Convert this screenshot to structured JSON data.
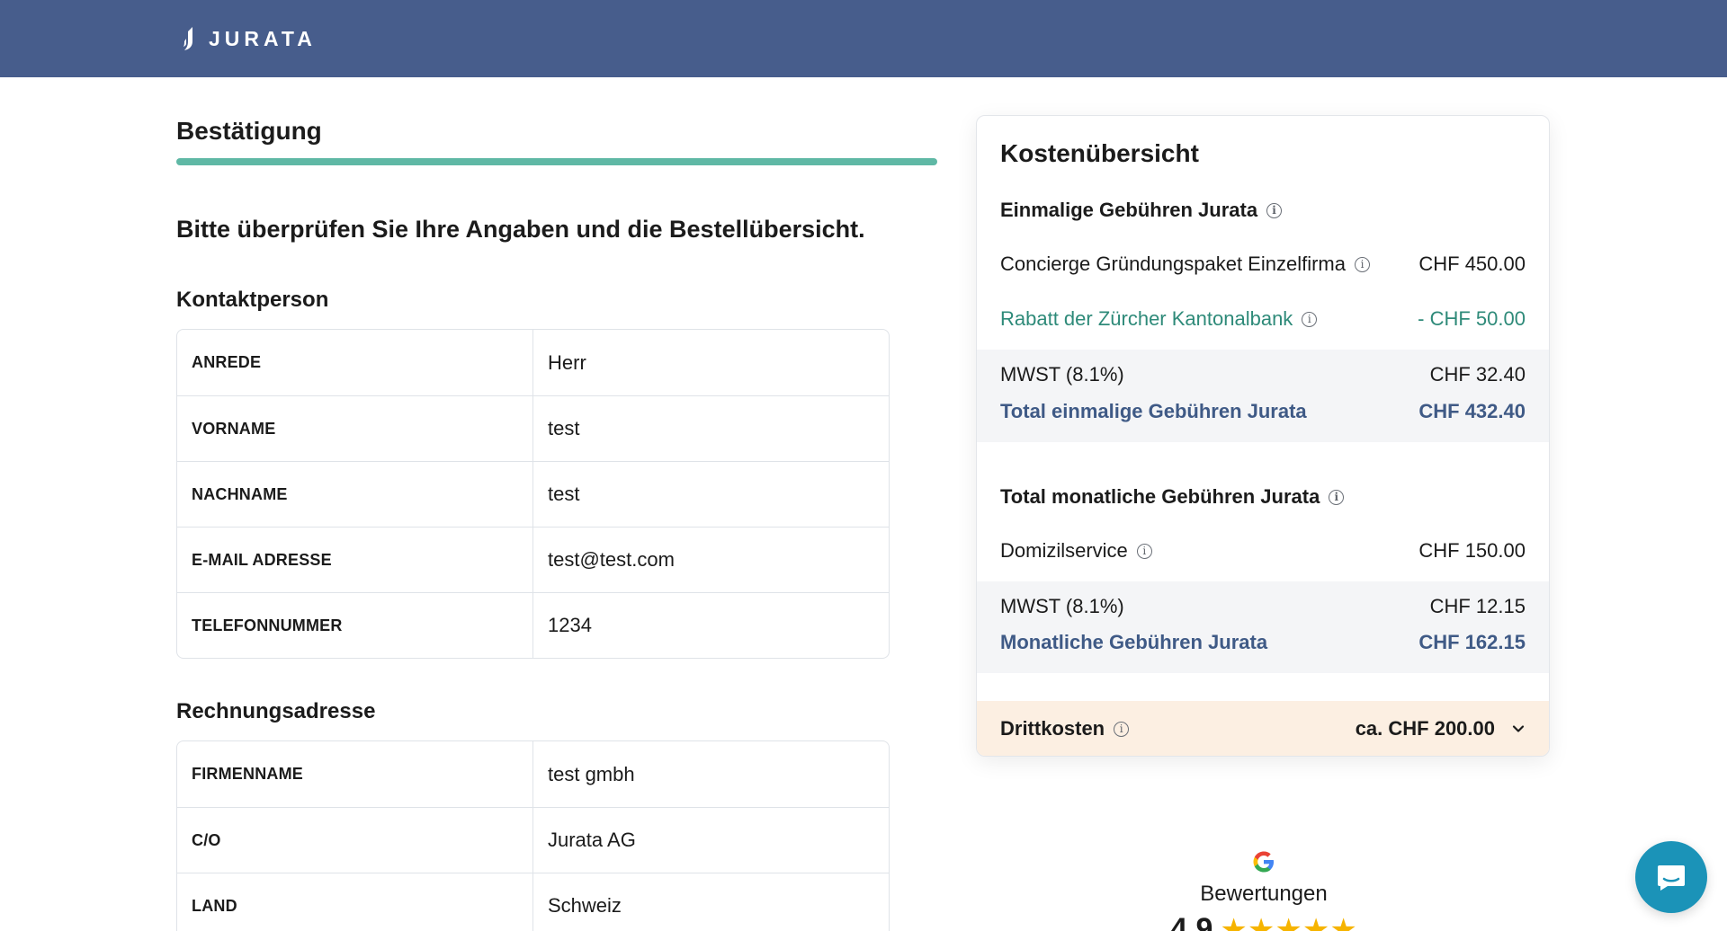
{
  "header": {
    "brand": "JURATA"
  },
  "page": {
    "title": "Bestätigung",
    "progress": 1.0,
    "intro": "Bitte überprüfen Sie Ihre Angaben und die Bestellübersicht."
  },
  "contact": {
    "title": "Kontaktperson",
    "rows": [
      {
        "key": "ANREDE",
        "value": "Herr"
      },
      {
        "key": "VORNAME",
        "value": "test"
      },
      {
        "key": "NACHNAME",
        "value": "test"
      },
      {
        "key": "E-MAIL ADRESSE",
        "value": "test@test.com"
      },
      {
        "key": "TELEFONNUMMER",
        "value": "1234"
      }
    ]
  },
  "billing": {
    "title": "Rechnungsadresse",
    "rows": [
      {
        "key": "FIRMENNAME",
        "value": "test gmbh"
      },
      {
        "key": "C/O",
        "value": "Jurata AG"
      },
      {
        "key": "LAND",
        "value": "Schweiz"
      }
    ]
  },
  "costs": {
    "title": "Kostenübersicht",
    "one_time": {
      "title": "Einmalige Gebühren Jurata",
      "package_label": "Concierge Gründungspaket Einzelfirma",
      "package_amount": "CHF 450.00",
      "discount_label": "Rabatt der Zürcher Kantonalbank",
      "discount_amount": "- CHF 50.00",
      "vat_label": "MWST (8.1%)",
      "vat_amount": "CHF 32.40",
      "total_label": "Total einmalige Gebühren Jurata",
      "total_amount": "CHF 432.40"
    },
    "monthly": {
      "title": "Total monatliche Gebühren Jurata",
      "service_label": "Domizilservice",
      "service_amount": "CHF 150.00",
      "vat_label": "MWST (8.1%)",
      "vat_amount": "CHF 12.15",
      "total_label": "Monatliche Gebühren Jurata",
      "total_amount": "CHF 162.15"
    },
    "third_party": {
      "label": "Drittkosten",
      "amount": "ca. CHF 200.00"
    }
  },
  "reviews": {
    "label": "Bewertungen",
    "score": "4.9",
    "stars": 5
  },
  "colors": {
    "header_bg": "#475d8c",
    "progress": "#5fb8a5",
    "discount": "#2e8a79",
    "total": "#3f5a86",
    "third_party_bg": "#fcefe2",
    "chat": "#1b93b8"
  }
}
